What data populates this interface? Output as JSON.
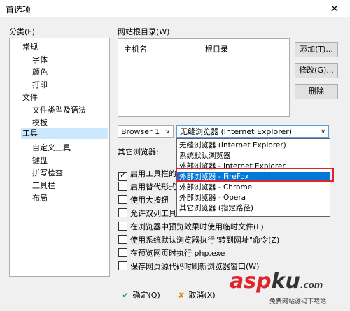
{
  "window": {
    "title": "首选项",
    "close": "×"
  },
  "category": {
    "label": "分类(F)",
    "items": [
      "常规",
      "字体",
      "颜色",
      "打印",
      "文件",
      "文件类型及语法",
      "模板",
      "工具",
      "自定义工具",
      "键盘",
      "拼写检查",
      "工具栏",
      "布局"
    ]
  },
  "website": {
    "label": "网站根目录(W):",
    "columns": [
      "主机名",
      "根目录"
    ],
    "add": "添加(T)...",
    "edit": "修改(G)...",
    "delete": "删除"
  },
  "browser": {
    "select": "Browser 1",
    "current": "无缝浏览器 (Internet Explorer)",
    "other_label": "其它浏览器:",
    "options": [
      "无缝浏览器 (Internet Explorer)",
      "系统默认浏览器",
      "外部浏览器 - Internet Explorer",
      "外部浏览器 - FireFox",
      "外部浏览器 - Chrome",
      "外部浏览器 - Opera",
      "其它浏览器 (指定路径)"
    ]
  },
  "checkboxes": [
    "启用工具栏的标",
    "启用替代形式的",
    "使用大按钮",
    "允许双列工具栏",
    "在浏览器中预览效果时使用临时文件(L)",
    "使用系统默认浏览器执行\"转到网址\"命令(Z)",
    "在预览网页时执行 php.exe",
    "保存网页源代码时刷新浏览器窗口(W)"
  ],
  "checked": [
    true,
    false,
    false,
    false,
    false,
    false,
    false,
    false
  ],
  "footer": {
    "ok": "确定(Q)",
    "cancel": "取消(X)"
  },
  "watermark": {
    "a": "asp",
    "b": "ku",
    "c": ".com",
    "sub": "免费网站源码下载站"
  }
}
